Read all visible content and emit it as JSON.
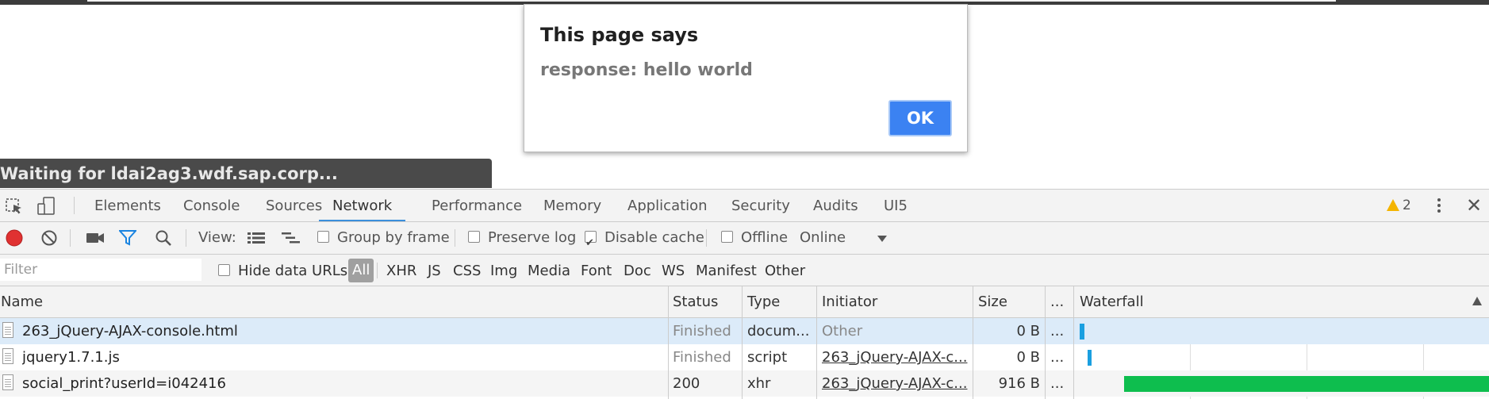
{
  "browser_status": "Waiting for ldai2ag3.wdf.sap.corp...",
  "dialog": {
    "title": "This page says",
    "message": "response: hello world",
    "ok_label": "OK"
  },
  "devtools": {
    "tabs": [
      "Elements",
      "Console",
      "Sources",
      "Network",
      "Performance",
      "Memory",
      "Application",
      "Security",
      "Audits",
      "UI5"
    ],
    "active_tab": "Network",
    "warning_count": "2",
    "toolbar": {
      "view_label": "View:",
      "group_by_frame": "Group by frame",
      "preserve_log": "Preserve log",
      "disable_cache": "Disable cache",
      "disable_cache_checked": true,
      "offline": "Offline",
      "throttle": "Online"
    },
    "filter": {
      "placeholder": "Filter",
      "hide_data_urls": "Hide data URLs",
      "types": [
        "All",
        "XHR",
        "JS",
        "CSS",
        "Img",
        "Media",
        "Font",
        "Doc",
        "WS",
        "Manifest",
        "Other"
      ]
    },
    "columns": {
      "name": "Name",
      "status": "Status",
      "type": "Type",
      "initiator": "Initiator",
      "size": "Size",
      "more": "...",
      "waterfall": "Waterfall"
    },
    "rows": [
      {
        "name": "263_jQuery-AJAX-console.html",
        "status": "Finished",
        "type": "docum...",
        "initiator": "Other",
        "size": "0 B",
        "more": "..."
      },
      {
        "name": "jquery1.7.1.js",
        "status": "Finished",
        "type": "script",
        "initiator": "263_jQuery-AJAX-c...",
        "size": "0 B",
        "more": "..."
      },
      {
        "name": "social_print?userId=i042416",
        "status": "200",
        "type": "xhr",
        "initiator": "263_jQuery-AJAX-c...",
        "size": "916 B",
        "more": "..."
      }
    ],
    "colors": {
      "accent": "#3b8fdb",
      "ok_button": "#3b82f2",
      "waterfall_blue": "#1a9fe0",
      "waterfall_green": "#0ebe4e"
    }
  }
}
